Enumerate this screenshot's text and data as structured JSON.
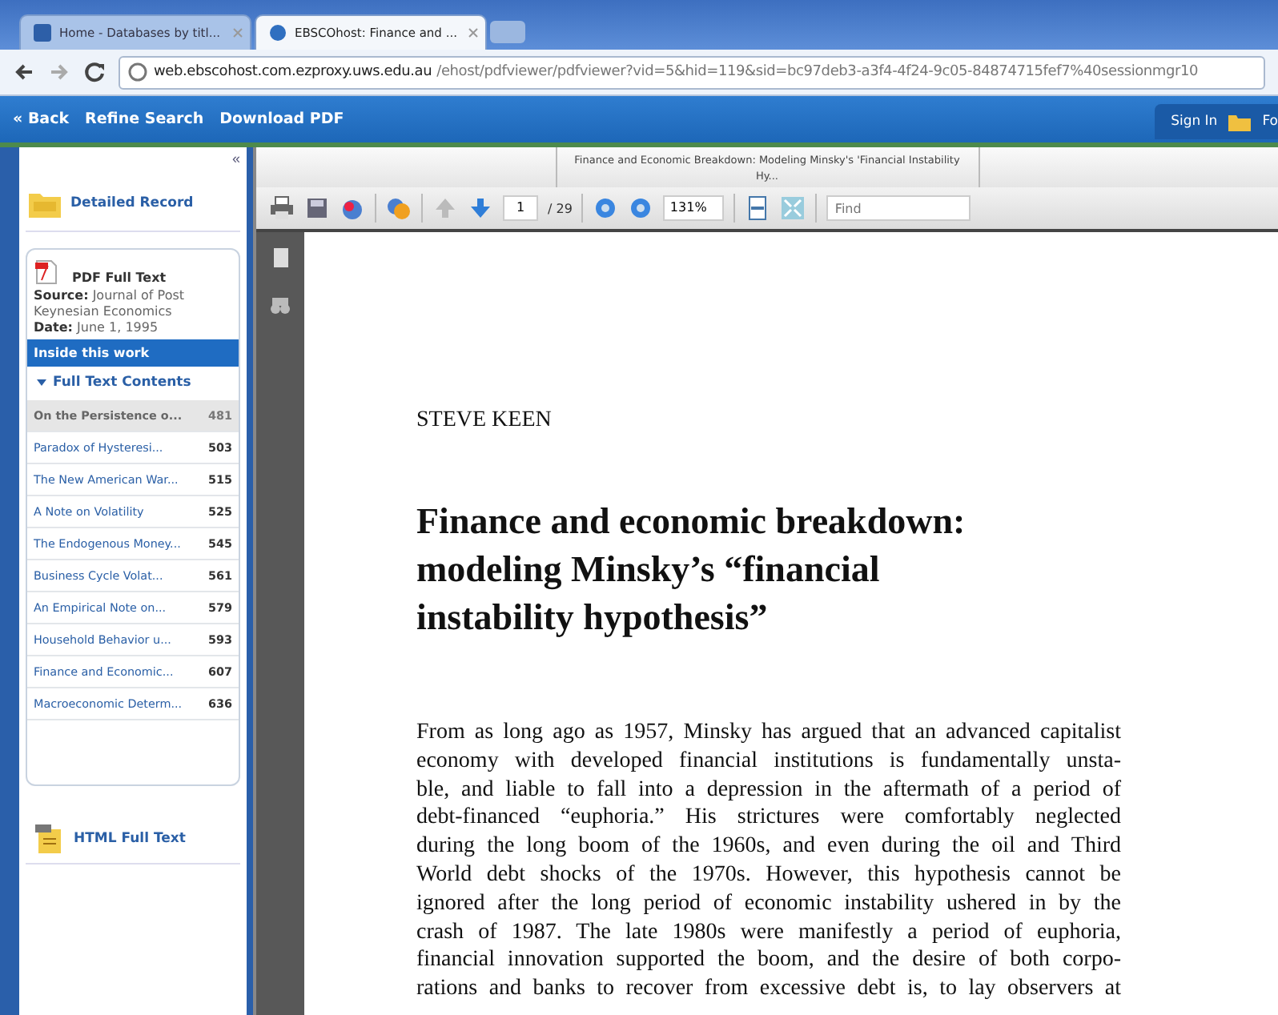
{
  "browser": {
    "tabs": [
      {
        "label": "Home - Databases by titl...",
        "selected": false
      },
      {
        "label": "EBSCOhost: Finance and ...",
        "selected": true
      }
    ],
    "url_host": "web.ebscohost.com.ezproxy.uws.edu.au",
    "url_path": "/ehost/pdfviewer/pdfviewer?vid=5&hid=119&sid=bc97deb3-a3f4-4f24-9c05-84874715fef7%40sessionmgr10"
  },
  "navbar": {
    "links": [
      "« Back",
      "Refine Search",
      "Download PDF"
    ],
    "sign_in": "Sign In",
    "folder": "Fo"
  },
  "sidebar": {
    "collapse": "«",
    "detailed_record": "Detailed Record",
    "pdf_label": "PDF Full Text",
    "source_label": "Source:",
    "source": "Journal of Post Keynesian Economics",
    "date_label": "Date:",
    "date": "June 1, 1995",
    "inside": "Inside this work",
    "contents": "Full Text Contents",
    "items": [
      {
        "title": "On the Persistence o...",
        "page": "481",
        "selected": true
      },
      {
        "title": "Paradox of Hysteresi...",
        "page": "503",
        "selected": false
      },
      {
        "title": "The New American War...",
        "page": "515",
        "selected": false
      },
      {
        "title": "A Note on Volatility",
        "page": "525",
        "selected": false
      },
      {
        "title": "The Endogenous Money...",
        "page": "545",
        "selected": false
      },
      {
        "title": "Business Cycle Volat...",
        "page": "561",
        "selected": false
      },
      {
        "title": "An Empirical Note on...",
        "page": "579",
        "selected": false
      },
      {
        "title": "Household Behavior u...",
        "page": "593",
        "selected": false
      },
      {
        "title": "Finance and Economic...",
        "page": "607",
        "selected": false
      },
      {
        "title": "Macroeconomic Determ...",
        "page": "636",
        "selected": false
      }
    ],
    "html_label": "HTML Full Text"
  },
  "viewer": {
    "doc_title": "Finance and Economic Breakdown: Modeling Minsky's 'Financial Instability Hy...",
    "page": "1",
    "pages": "/ 29",
    "zoom": "131%",
    "find_placeholder": "Find"
  },
  "document": {
    "author": "STEVE KEEN",
    "title": "Finance and economic breakdown: modeling Minsky’s “financial instability hypothesis”",
    "lines": [
      "From as long ago as 1957, Minsky has argued that an advanced capitalist",
      "economy with developed financial institutions is fundamentally unsta-",
      "ble, and liable to fall into a depression in the aftermath of a period of",
      "debt-financed “euphoria.” His strictures were comfortably neglected",
      "during the long boom of the 1960s, and even during the oil and Third",
      "World debt shocks of the 1970s. However, this hypothesis cannot be",
      "ignored after the long period of economic instability ushered in by the",
      "crash of 1987. The late 1980s were manifestly a period of euphoria,",
      "financial innovation supported the boom, and the desire of both corpo-",
      "rations and banks to recover from excessive debt is, to lay observers at"
    ]
  }
}
